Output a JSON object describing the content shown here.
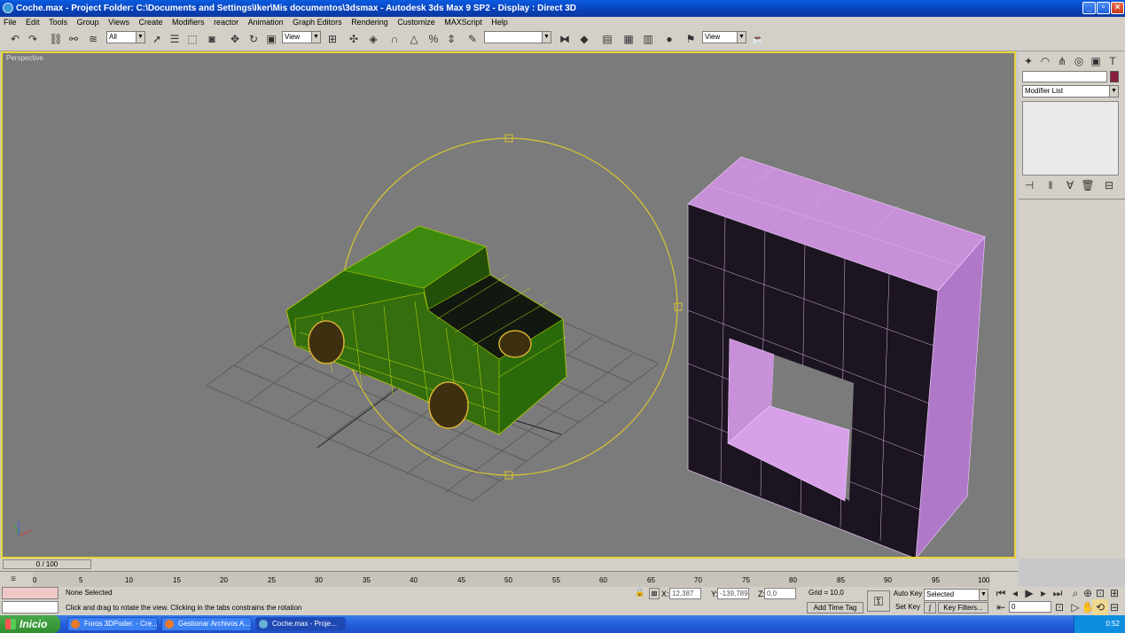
{
  "window": {
    "title": "Coche.max     - Project Folder: C:\\Documents and Settings\\Iker\\Mis documentos\\3dsmax     - Autodesk 3ds Max 9 SP2     - Display : Direct 3D"
  },
  "menu": [
    "File",
    "Edit",
    "Tools",
    "Group",
    "Views",
    "Create",
    "Modifiers",
    "reactor",
    "Animation",
    "Graph Editors",
    "Rendering",
    "Customize",
    "MAXScript",
    "Help"
  ],
  "toolbar": {
    "selection_filter": "All",
    "ref_coord": "View",
    "named_selection": "",
    "render_view": "View"
  },
  "viewport": {
    "label": "Perspective"
  },
  "command_panel": {
    "modifier_list": "Modifier List",
    "object_color": "#8a1f3c"
  },
  "timeline": {
    "frame_counter": "0 / 100",
    "ticks": [
      "0",
      "5",
      "10",
      "15",
      "20",
      "25",
      "30",
      "35",
      "40",
      "45",
      "50",
      "55",
      "60",
      "65",
      "70",
      "75",
      "80",
      "85",
      "90",
      "95",
      "100"
    ]
  },
  "status": {
    "selection": "None Selected",
    "prompt": "Click and drag to rotate the view.  Clicking in the tabs constrains the rotation",
    "x_label": "X:",
    "x_value": "12,387",
    "y_label": "Y:",
    "y_value": "-139,789",
    "z_label": "Z:",
    "z_value": "0,0",
    "grid": "Grid = 10,0",
    "add_time_tag": "Add Time Tag",
    "auto_key": "Auto Key",
    "set_key": "Set Key",
    "key_mode": "Selected",
    "key_filters": "Key Filters...",
    "current_frame": "0"
  },
  "taskbar": {
    "start": "Inicio",
    "tasks": [
      "Foros 3DPoder. - Cre...",
      "Gestionar Archivos A...",
      "Coche.max     - Proje..."
    ],
    "clock": "0:52"
  }
}
